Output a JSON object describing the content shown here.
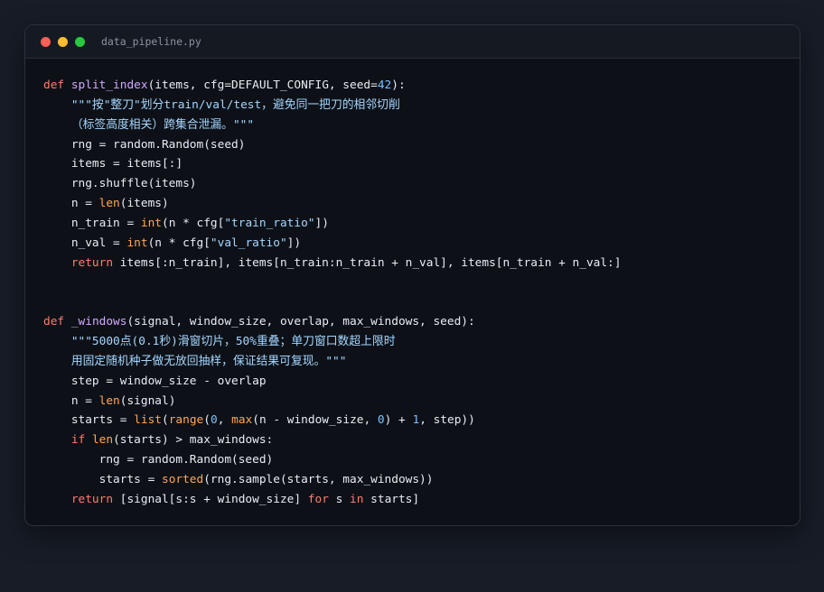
{
  "window": {
    "filename": "data_pipeline.py",
    "controls": [
      "close",
      "minimize",
      "maximize"
    ]
  },
  "colors": {
    "keyword": "#ff7b72",
    "function": "#d2a8ff",
    "builtin": "#ffa657",
    "string": "#a5d6ff",
    "number": "#79c0ff",
    "text": "#e6edf3",
    "background": "#0d1117",
    "page_background": "#171c26"
  },
  "code": {
    "lines": [
      [
        [
          "kw",
          "def "
        ],
        [
          "fn",
          "split_index"
        ],
        [
          "plain",
          "(items, cfg=DEFAULT_CONFIG, seed="
        ],
        [
          "num",
          "42"
        ],
        [
          "plain",
          "):"
        ]
      ],
      [
        [
          "doc",
          "    \"\"\"按\"整刀\"划分train/val/test，避免同一把刀的相邻切削"
        ]
      ],
      [
        [
          "doc",
          "    （标签高度相关）跨集合泄漏。\"\"\""
        ]
      ],
      [
        [
          "plain",
          "    rng = random.Random(seed)"
        ]
      ],
      [
        [
          "plain",
          "    items = items[:]"
        ]
      ],
      [
        [
          "plain",
          "    rng.shuffle(items)"
        ]
      ],
      [
        [
          "plain",
          "    n = "
        ],
        [
          "bi",
          "len"
        ],
        [
          "plain",
          "(items)"
        ]
      ],
      [
        [
          "plain",
          "    n_train = "
        ],
        [
          "bi",
          "int"
        ],
        [
          "plain",
          "(n * cfg["
        ],
        [
          "str",
          "\"train_ratio\""
        ],
        [
          "plain",
          "])"
        ]
      ],
      [
        [
          "plain",
          "    n_val = "
        ],
        [
          "bi",
          "int"
        ],
        [
          "plain",
          "(n * cfg["
        ],
        [
          "str",
          "\"val_ratio\""
        ],
        [
          "plain",
          "])"
        ]
      ],
      [
        [
          "kw",
          "    return"
        ],
        [
          "plain",
          " items[:n_train], items[n_train:n_train + n_val], items[n_train + n_val:]"
        ]
      ],
      [],
      [],
      [
        [
          "kw",
          "def "
        ],
        [
          "fn",
          "_windows"
        ],
        [
          "plain",
          "(signal, window_size, overlap, max_windows, seed):"
        ]
      ],
      [
        [
          "doc",
          "    \"\"\"5000点(0.1秒)滑窗切片，50%重叠；单刀窗口数超上限时"
        ]
      ],
      [
        [
          "doc",
          "    用固定随机种子做无放回抽样，保证结果可复现。\"\"\""
        ]
      ],
      [
        [
          "plain",
          "    step = window_size - overlap"
        ]
      ],
      [
        [
          "plain",
          "    n = "
        ],
        [
          "bi",
          "len"
        ],
        [
          "plain",
          "(signal)"
        ]
      ],
      [
        [
          "plain",
          "    starts = "
        ],
        [
          "bi",
          "list"
        ],
        [
          "plain",
          "("
        ],
        [
          "bi",
          "range"
        ],
        [
          "plain",
          "("
        ],
        [
          "num",
          "0"
        ],
        [
          "plain",
          ", "
        ],
        [
          "bi",
          "max"
        ],
        [
          "plain",
          "(n - window_size, "
        ],
        [
          "num",
          "0"
        ],
        [
          "plain",
          ") + "
        ],
        [
          "num",
          "1"
        ],
        [
          "plain",
          ", step))"
        ]
      ],
      [
        [
          "kw",
          "    if "
        ],
        [
          "bi",
          "len"
        ],
        [
          "plain",
          "(starts) > max_windows:"
        ]
      ],
      [
        [
          "plain",
          "        rng = random.Random(seed)"
        ]
      ],
      [
        [
          "plain",
          "        starts = "
        ],
        [
          "bi",
          "sorted"
        ],
        [
          "plain",
          "(rng.sample(starts, max_windows))"
        ]
      ],
      [
        [
          "kw",
          "    return"
        ],
        [
          "plain",
          " [signal[s:s + window_size] "
        ],
        [
          "kw",
          "for"
        ],
        [
          "plain",
          " s "
        ],
        [
          "kw",
          "in"
        ],
        [
          "plain",
          " starts]"
        ]
      ]
    ]
  }
}
